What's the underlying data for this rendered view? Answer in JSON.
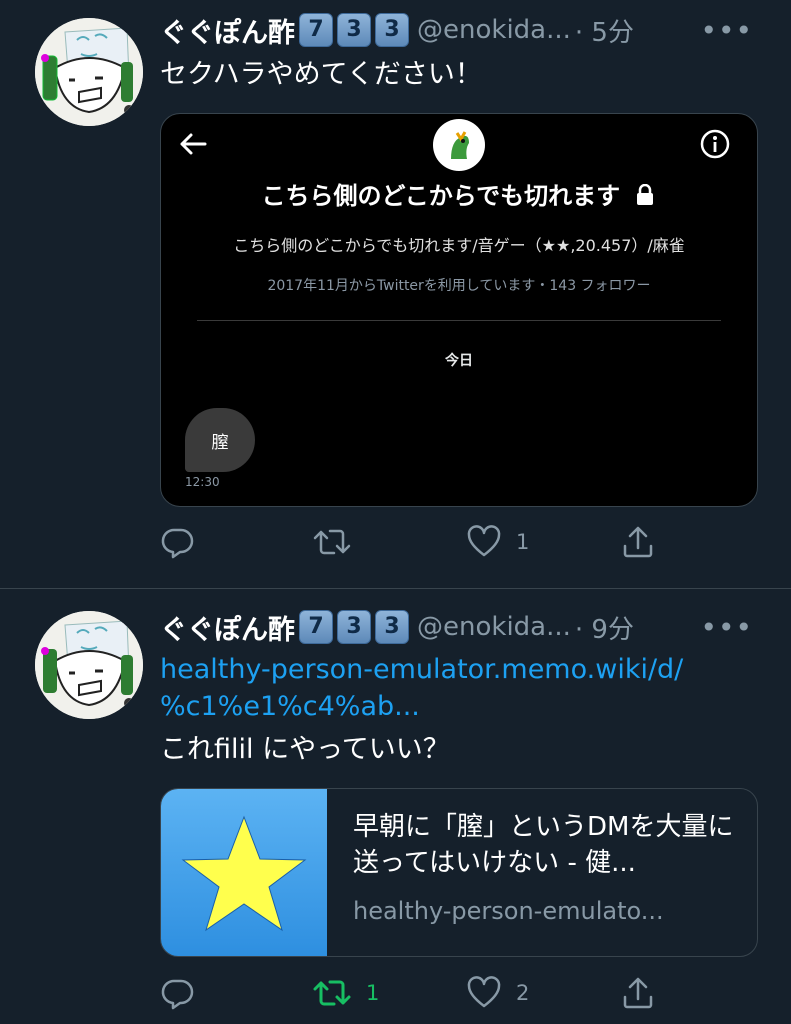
{
  "tweets": [
    {
      "name": "ぐぐぽん酢",
      "keycaps": [
        "7",
        "3",
        "3"
      ],
      "handle": "@enokida...",
      "time": "· 5分",
      "text": "セクハラやめてください！",
      "embed": {
        "title": "こちら側のどこからでも切れます",
        "bio": "こちら側のどこからでも切れます/音ゲー（★★,20.457）/麻雀",
        "meta": "2017年11月からTwitterを利用しています・143 フォロワー",
        "date_divider": "今日",
        "message": "膣",
        "message_time": "12:30"
      },
      "actions": {
        "reply_count": "",
        "retweet_count": "",
        "like_count": "1"
      }
    },
    {
      "name": "ぐぐぽん酢",
      "keycaps": [
        "7",
        "3",
        "3"
      ],
      "handle": "@enokida...",
      "time": "· 9分",
      "link_line1": "healthy-person-emulator.memo.wiki/d/",
      "link_line2": "%c1%e1%c4%ab...",
      "text": "これfilil にやっていい？",
      "card": {
        "title": "早朝に「膣」というDMを大量に送ってはいけない - 健...",
        "domain": "healthy-person-emulato..."
      },
      "actions": {
        "reply_count": "",
        "retweet_count": "1",
        "like_count": "2"
      }
    }
  ],
  "colors": {
    "background": "#15202b",
    "link": "#1da1f2",
    "retweet_active": "#17bf63",
    "muted": "#8899a6"
  }
}
